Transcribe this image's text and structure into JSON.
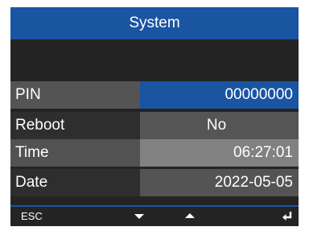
{
  "title": "System",
  "rows": [
    {
      "label": "PIN",
      "value": "00000000"
    },
    {
      "label": "Reboot",
      "value": "No"
    },
    {
      "label": "Time",
      "value": "06:27:01"
    },
    {
      "label": "Date",
      "value": "2022-05-05"
    }
  ],
  "footer": {
    "esc_label": "ESC",
    "down_icon": "triangle-down-icon",
    "up_icon": "triangle-up-icon",
    "enter_icon": "enter-return-icon"
  },
  "colors": {
    "title_bar": "#1a55a2",
    "selected_value": "#1a55a2",
    "background": "#242424"
  }
}
